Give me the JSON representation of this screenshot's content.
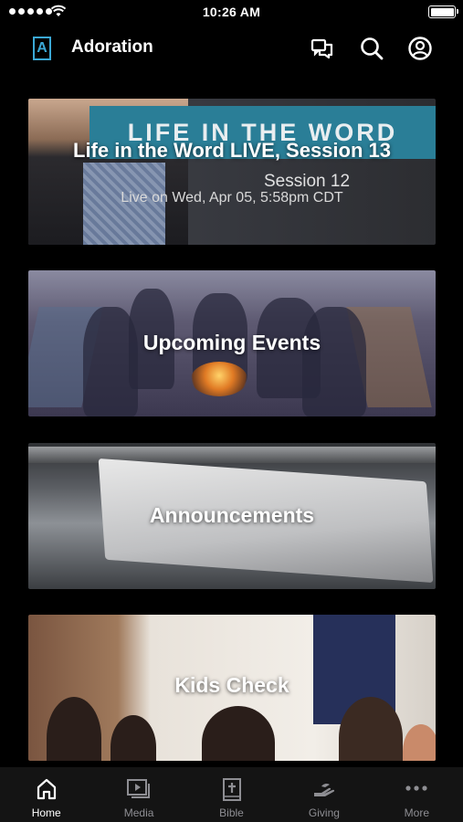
{
  "status_bar": {
    "time": "10:26 AM"
  },
  "header": {
    "app_title": "Adoration",
    "logo_letter": "A"
  },
  "cards": [
    {
      "banner": "LIFE IN THE WORD",
      "title": "Life in the Word LIVE, Session 13",
      "ghost_text": "Session 12",
      "subtitle": "Live on Wed, Apr 05, 5:58pm CDT"
    },
    {
      "title": "Upcoming Events"
    },
    {
      "title": "Announcements"
    },
    {
      "title": "Kids Check"
    }
  ],
  "tabs": [
    {
      "label": "Home",
      "icon": "home-icon",
      "active": true
    },
    {
      "label": "Media",
      "icon": "media-icon"
    },
    {
      "label": "Bible",
      "icon": "bible-icon"
    },
    {
      "label": "Giving",
      "icon": "giving-icon"
    },
    {
      "label": "More",
      "icon": "more-icon"
    }
  ],
  "colors": {
    "accent": "#3ba8d6",
    "banner": "#2a7e97",
    "tabbar": "#141414"
  }
}
